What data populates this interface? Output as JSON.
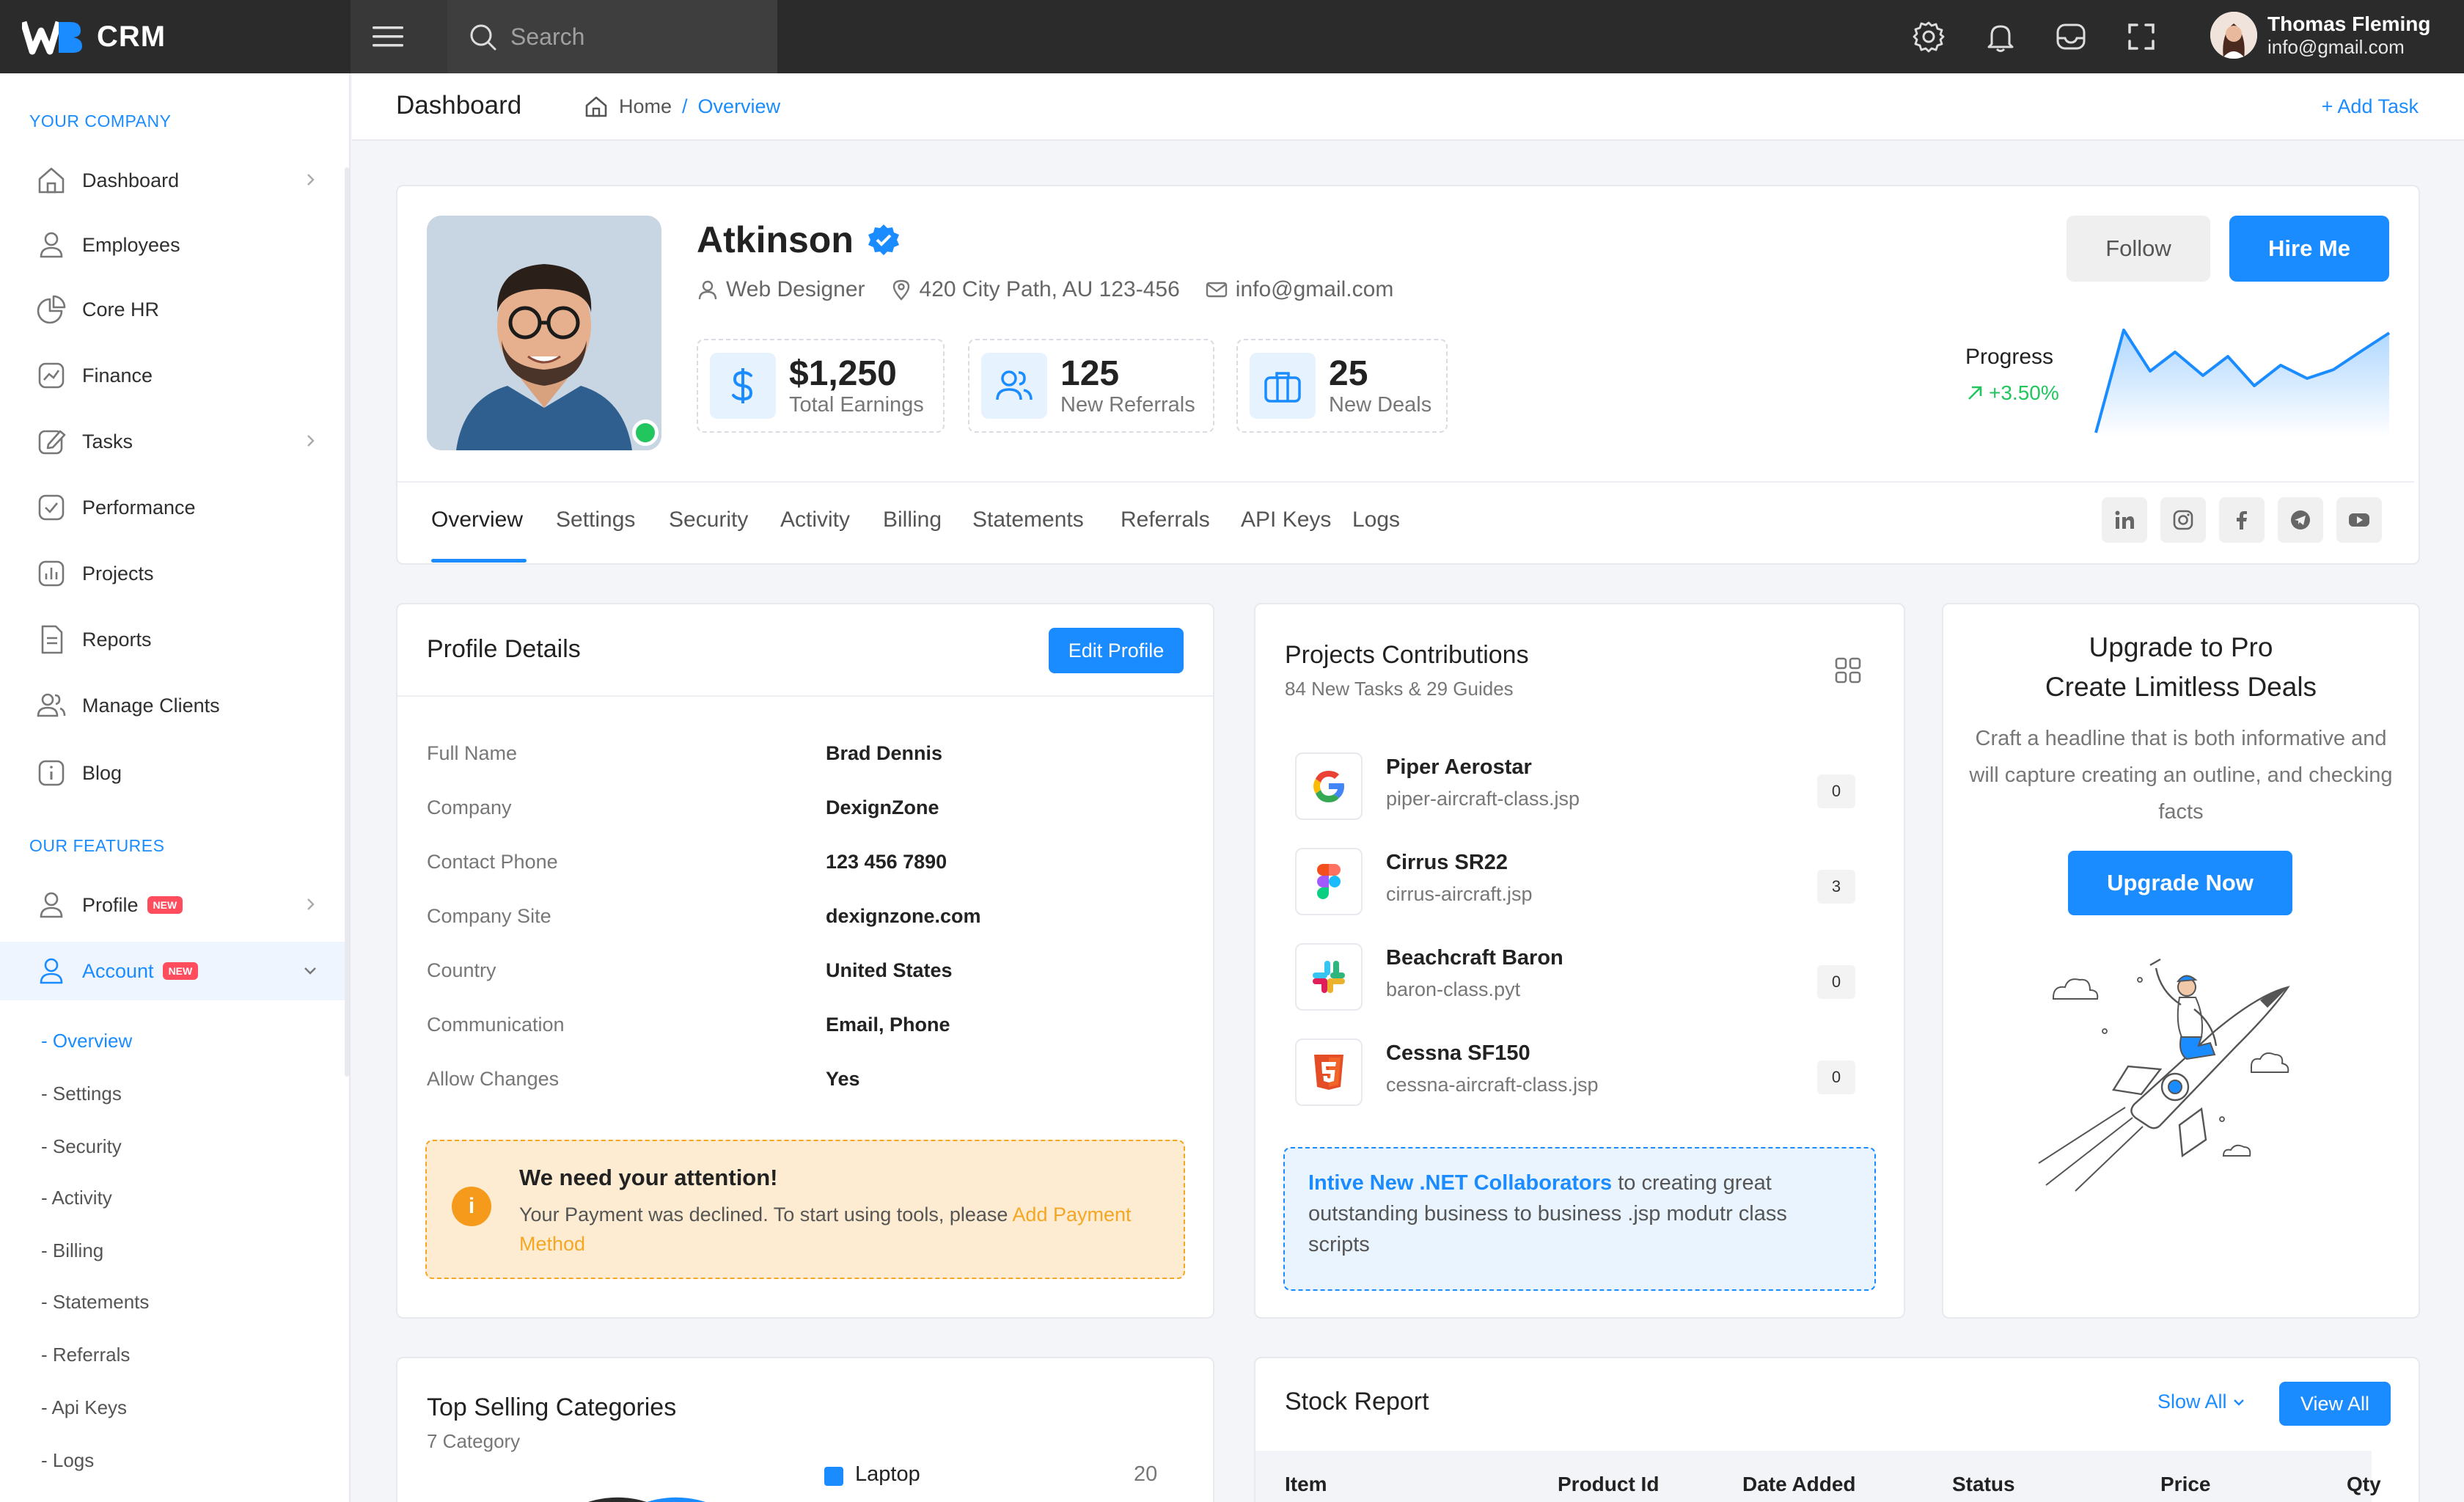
{
  "topbar": {
    "logo_text": "CRM",
    "search_placeholder": "Search",
    "user_name": "Thomas Fleming",
    "user_email": "info@gmail.com"
  },
  "sidebar": {
    "section_company": "YOUR COMPANY",
    "items": [
      {
        "label": "Dashboard"
      },
      {
        "label": "Employees"
      },
      {
        "label": "Core HR"
      },
      {
        "label": "Finance"
      },
      {
        "label": "Tasks"
      },
      {
        "label": "Performance"
      },
      {
        "label": "Projects"
      },
      {
        "label": "Reports"
      },
      {
        "label": "Manage Clients"
      },
      {
        "label": "Blog"
      }
    ],
    "section_features": "OUR FEATURES",
    "profile_label": "Profile",
    "account_label": "Account",
    "badge_new": "NEW",
    "sub_items": [
      "- Overview",
      "- Settings",
      "- Security",
      "- Activity",
      "- Billing",
      "- Statements",
      "- Referrals",
      "- Api Keys",
      "- Logs"
    ]
  },
  "pagebar": {
    "title": "Dashboard",
    "crumb_home": "Home",
    "crumb_sep": "/",
    "crumb_current": "Overview",
    "add_task": "+ Add Task"
  },
  "profile": {
    "name": "Atkinson",
    "role": "Web Designer",
    "address": "420 City Path, AU 123-456",
    "email": "info@gmail.com",
    "stats": [
      {
        "value": "$1,250",
        "label": "Total Earnings"
      },
      {
        "value": "125",
        "label": "New Referrals"
      },
      {
        "value": "25",
        "label": "New Deals"
      }
    ],
    "follow_label": "Follow",
    "hire_label": "Hire Me",
    "progress_label": "Progress",
    "progress_value": "+3.50%",
    "tabs": [
      "Overview",
      "Settings",
      "Security",
      "Activity",
      "Billing",
      "Statements",
      "Referrals",
      "API Keys",
      "Logs"
    ],
    "social": [
      "linkedin-icon",
      "instagram-icon",
      "facebook-icon",
      "telegram-icon",
      "youtube-icon"
    ]
  },
  "details": {
    "title": "Profile Details",
    "edit_label": "Edit Profile",
    "rows": [
      {
        "label": "Full Name",
        "value": "Brad Dennis"
      },
      {
        "label": "Company",
        "value": "DexignZone"
      },
      {
        "label": "Contact Phone",
        "value": "123 456 7890"
      },
      {
        "label": "Company Site",
        "value": "dexignzone.com"
      },
      {
        "label": "Country",
        "value": "United States"
      },
      {
        "label": "Communication",
        "value": "Email, Phone"
      },
      {
        "label": "Allow Changes",
        "value": "Yes"
      }
    ],
    "alert_title": "We need your attention!",
    "alert_text": "Your Payment was declined. To start using tools, please",
    "alert_link": "Add Payment Method"
  },
  "projects": {
    "title": "Projects Contributions",
    "subtitle": "84 New Tasks & 29 Guides",
    "items": [
      {
        "name": "Piper Aerostar",
        "file": "piper-aircraft-class.jsp",
        "count": "0"
      },
      {
        "name": "Cirrus SR22",
        "file": "cirrus-aircraft.jsp",
        "count": "3"
      },
      {
        "name": "Beachcraft Baron",
        "file": "baron-class.pyt",
        "count": "0"
      },
      {
        "name": "Cessna SF150",
        "file": "cessna-aircraft-class.jsp",
        "count": "0"
      }
    ],
    "info_bold": "Intive New .NET Collaborators",
    "info_text": "to creating great outstanding business to business .jsp modutr class scripts"
  },
  "upgrade": {
    "title_line1": "Upgrade to Pro",
    "title_line2": "Create Limitless Deals",
    "text": "Craft a headline that is both informative and will capture creating an outline, and checking facts",
    "button": "Upgrade Now"
  },
  "selling": {
    "title": "Top Selling Categories",
    "subtitle": "7 Category",
    "legend": [
      {
        "label": "Laptop",
        "value": "20"
      }
    ]
  },
  "stock": {
    "title": "Stock Report",
    "slow_all": "Slow All",
    "view_all": "View All",
    "columns": [
      "Item",
      "Product Id",
      "Date Added",
      "Status",
      "Price",
      "Qty"
    ]
  },
  "colors": {
    "accent": "#1a8cff",
    "topbar": "#2b2b2b",
    "success": "#22c55e",
    "warning": "#f5a623"
  }
}
